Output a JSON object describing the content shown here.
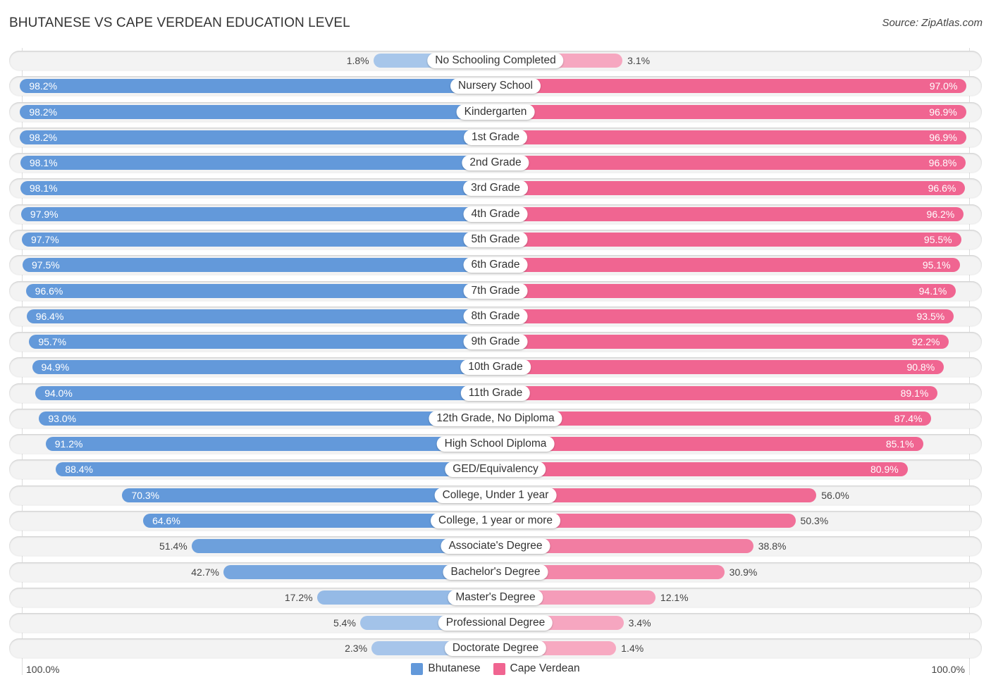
{
  "title": "BHUTANESE VS CAPE VERDEAN EDUCATION LEVEL",
  "source": "Source: ZipAtlas.com",
  "axis": {
    "left_label": "100.0%",
    "right_label": "100.0%"
  },
  "legend": [
    {
      "name": "Bhutanese",
      "color": "#6399da"
    },
    {
      "name": "Cape Verdean",
      "color": "#f06591"
    }
  ],
  "chart_data": {
    "type": "bar",
    "orientation": "horizontal-diverging",
    "title": "BHUTANESE VS CAPE VERDEAN EDUCATION LEVEL",
    "xlabel": "",
    "ylabel": "",
    "xlim": [
      0,
      100
    ],
    "unit": "%",
    "legend_position": "bottom",
    "categories": [
      "No Schooling Completed",
      "Nursery School",
      "Kindergarten",
      "1st Grade",
      "2nd Grade",
      "3rd Grade",
      "4th Grade",
      "5th Grade",
      "6th Grade",
      "7th Grade",
      "8th Grade",
      "9th Grade",
      "10th Grade",
      "11th Grade",
      "12th Grade, No Diploma",
      "High School Diploma",
      "GED/Equivalency",
      "College, Under 1 year",
      "College, 1 year or more",
      "Associate's Degree",
      "Bachelor's Degree",
      "Master's Degree",
      "Professional Degree",
      "Doctorate Degree"
    ],
    "series": [
      {
        "name": "Bhutanese",
        "color": "#6399da",
        "values": [
          1.8,
          98.2,
          98.2,
          98.2,
          98.1,
          98.1,
          97.9,
          97.7,
          97.5,
          96.6,
          96.4,
          95.7,
          94.9,
          94.0,
          93.0,
          91.2,
          88.4,
          70.3,
          64.6,
          51.4,
          42.7,
          17.2,
          5.4,
          2.3
        ]
      },
      {
        "name": "Cape Verdean",
        "color": "#f06591",
        "values": [
          3.1,
          97.0,
          96.9,
          96.9,
          96.8,
          96.6,
          96.2,
          95.5,
          95.1,
          94.1,
          93.5,
          92.2,
          90.8,
          89.1,
          87.4,
          85.1,
          80.9,
          56.0,
          50.3,
          38.8,
          30.9,
          12.1,
          3.4,
          1.4
        ]
      }
    ]
  }
}
